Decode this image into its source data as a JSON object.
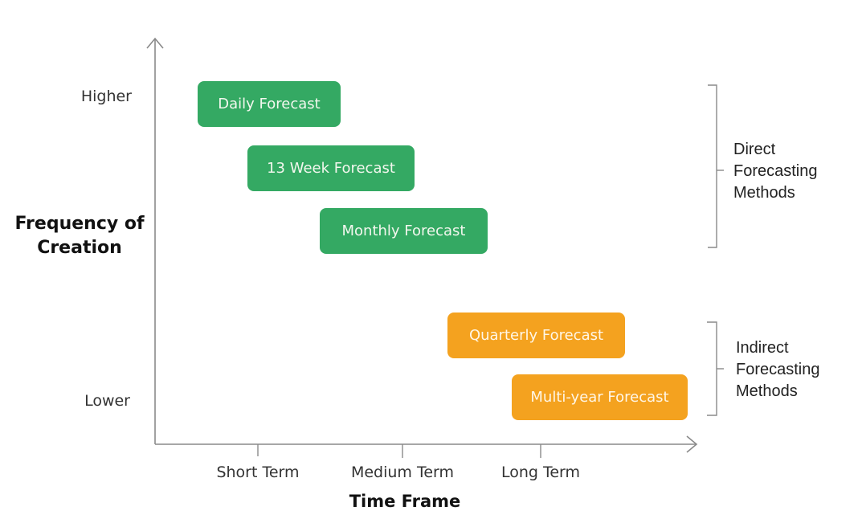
{
  "diagram": {
    "y_axis": {
      "title": "Frequency of Creation",
      "title_line1": "Frequency of",
      "title_line2": "Creation",
      "high_label": "Higher",
      "low_label": "Lower"
    },
    "x_axis": {
      "title": "Time Frame",
      "ticks": [
        "Short Term",
        "Medium Term",
        "Long Term"
      ]
    },
    "colors": {
      "direct": "#34a963",
      "indirect": "#f4a21f",
      "axis": "#888888"
    },
    "forecasts": [
      {
        "label": "Daily Forecast",
        "group": "direct",
        "frequency_rank": 1,
        "time_frame": "Short Term"
      },
      {
        "label": "13 Week Forecast",
        "group": "direct",
        "frequency_rank": 2,
        "time_frame": "Short-Medium Term"
      },
      {
        "label": "Monthly Forecast",
        "group": "direct",
        "frequency_rank": 3,
        "time_frame": "Medium Term"
      },
      {
        "label": "Quarterly Forecast",
        "group": "indirect",
        "frequency_rank": 4,
        "time_frame": "Medium-Long Term"
      },
      {
        "label": "Multi-year Forecast",
        "group": "indirect",
        "frequency_rank": 5,
        "time_frame": "Long Term"
      }
    ],
    "groups": [
      {
        "id": "direct",
        "line1": "Direct",
        "line2": "Forecasting",
        "line3": "Methods"
      },
      {
        "id": "indirect",
        "line1": "Indirect",
        "line2": "Forecasting",
        "line3": "Methods"
      }
    ]
  }
}
